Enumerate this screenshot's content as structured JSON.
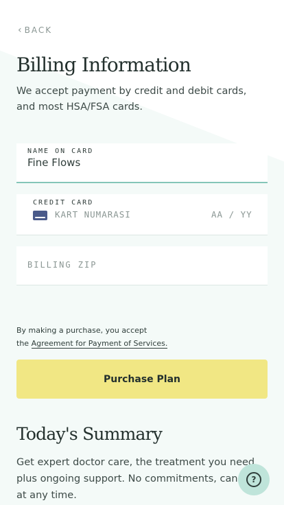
{
  "nav": {
    "back_label": "BACK"
  },
  "header": {
    "title": "Billing Information",
    "intro": "We accept payment by credit and debit cards, and most HSA/FSA cards."
  },
  "form": {
    "name_on_card": {
      "label": "NAME ON CARD",
      "value": "Fine Flows"
    },
    "credit_card": {
      "label": "CREDIT CARD",
      "number_placeholder": "KART NUMARASI",
      "expiry_placeholder": "AA / YY"
    },
    "billing_zip": {
      "placeholder": "BILLING ZIP"
    }
  },
  "terms": {
    "line1": "By making a purchase, you accept",
    "prefix": "the ",
    "link_text": "Agreement for Payment of Services."
  },
  "purchase_button": {
    "label": "Purchase Plan"
  },
  "summary": {
    "title": "Today's Summary",
    "text": "Get expert doctor care, the treatment you need plus ongoing support. No commitments, cancel at any time."
  },
  "help": {
    "icon": "question-icon",
    "label": "?"
  },
  "colors": {
    "button_yellow": "#f1e784",
    "focus_teal": "#84c5b8",
    "help_bg": "#bfe4da"
  }
}
